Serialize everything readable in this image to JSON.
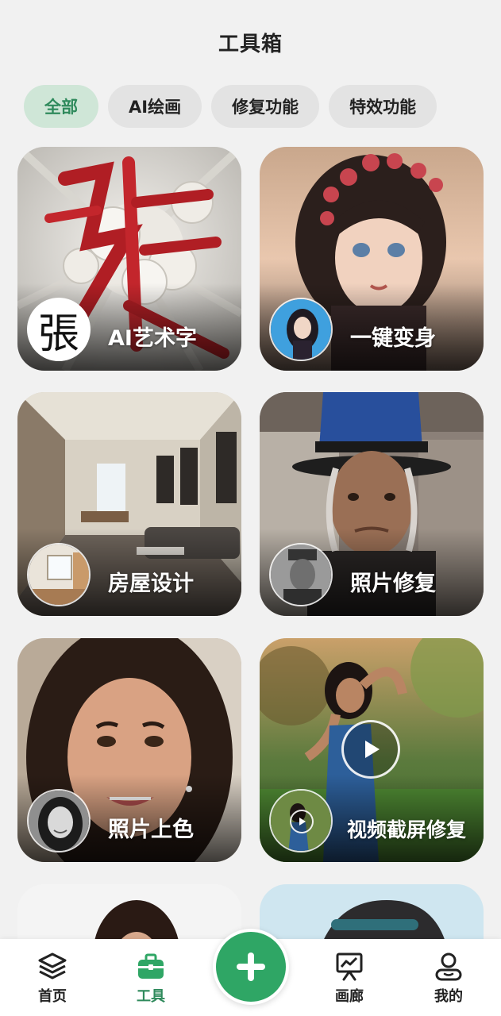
{
  "header": {
    "title": "工具箱"
  },
  "chips": [
    {
      "label": "全部",
      "active": true
    },
    {
      "label": "AI绘画",
      "active": false
    },
    {
      "label": "修复功能",
      "active": false
    },
    {
      "label": "特效功能",
      "active": false
    }
  ],
  "tools": [
    {
      "label": "AI艺术字",
      "thumb_char": "張"
    },
    {
      "label": "一键变身"
    },
    {
      "label": "房屋设计"
    },
    {
      "label": "照片修复"
    },
    {
      "label": "照片上色"
    },
    {
      "label": "视频截屏修复"
    }
  ],
  "bottom_nav": {
    "home": "首页",
    "tools": "工具",
    "gallery": "画廊",
    "mine": "我的"
  },
  "colors": {
    "accent": "#2fa665",
    "accent_text": "#2f8a5c",
    "chip_active_bg": "#cfe6d7"
  }
}
